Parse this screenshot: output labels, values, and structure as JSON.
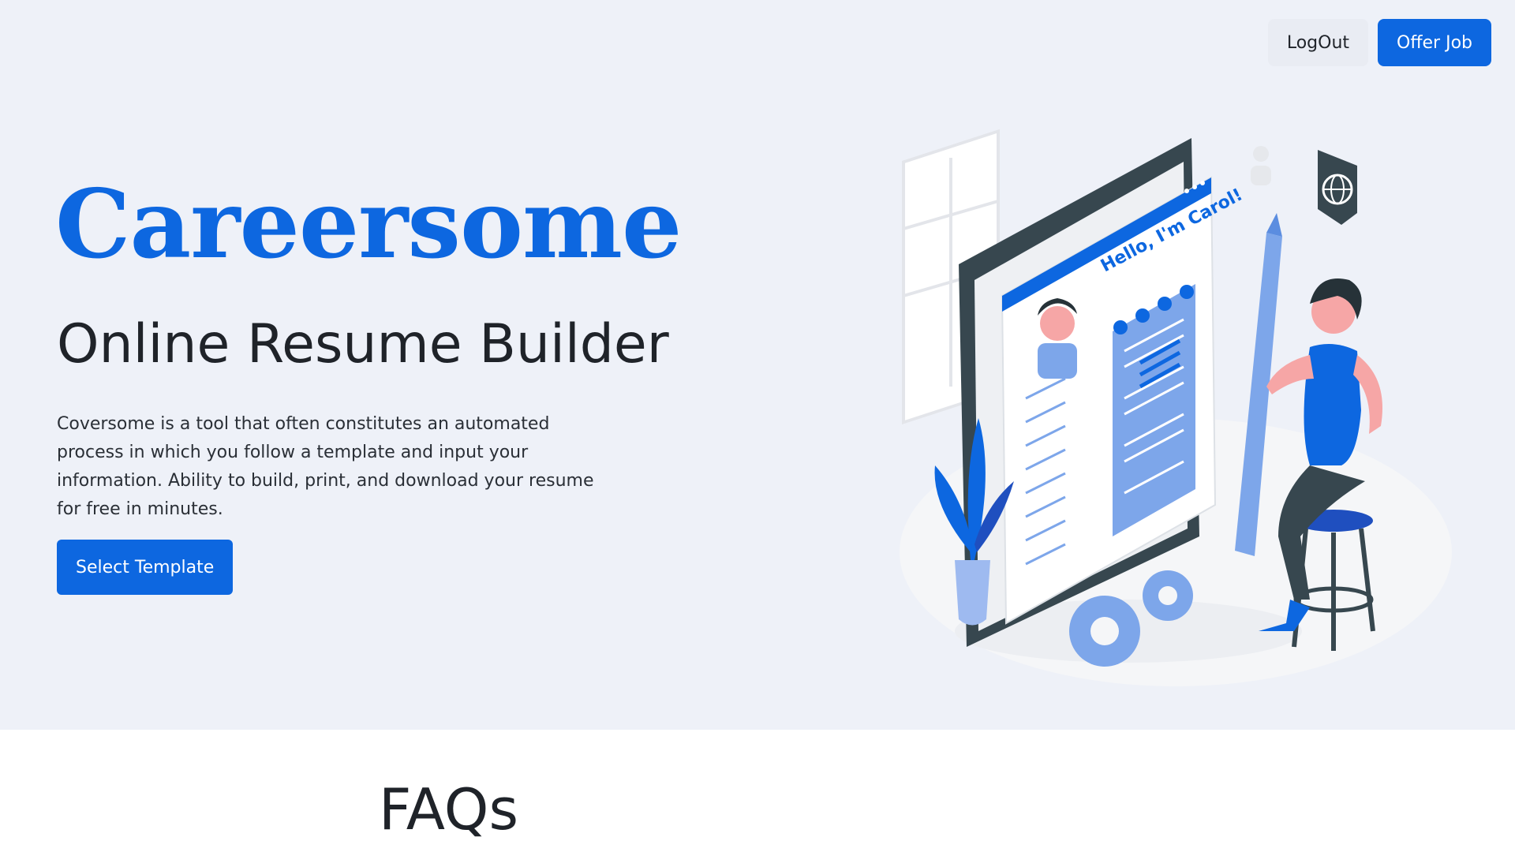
{
  "nav": {
    "logout_label": "LogOut",
    "offer_label": "Offer Job"
  },
  "hero": {
    "brand": "Careersome",
    "subtitle": "Online Resume Builder",
    "description": "Coversome is a tool that often constitutes an automated process in which you follow a template and input your information. Ability to build, print, and download your resume for free in minutes.",
    "cta_label": "Select Template"
  },
  "illustration": {
    "greeting": "Hello, I'm Carol!"
  },
  "faq": {
    "title": "FAQs"
  },
  "colors": {
    "accent": "#0d67e0",
    "hero_bg": "#eef1f8",
    "text_dark": "#1f2329"
  }
}
